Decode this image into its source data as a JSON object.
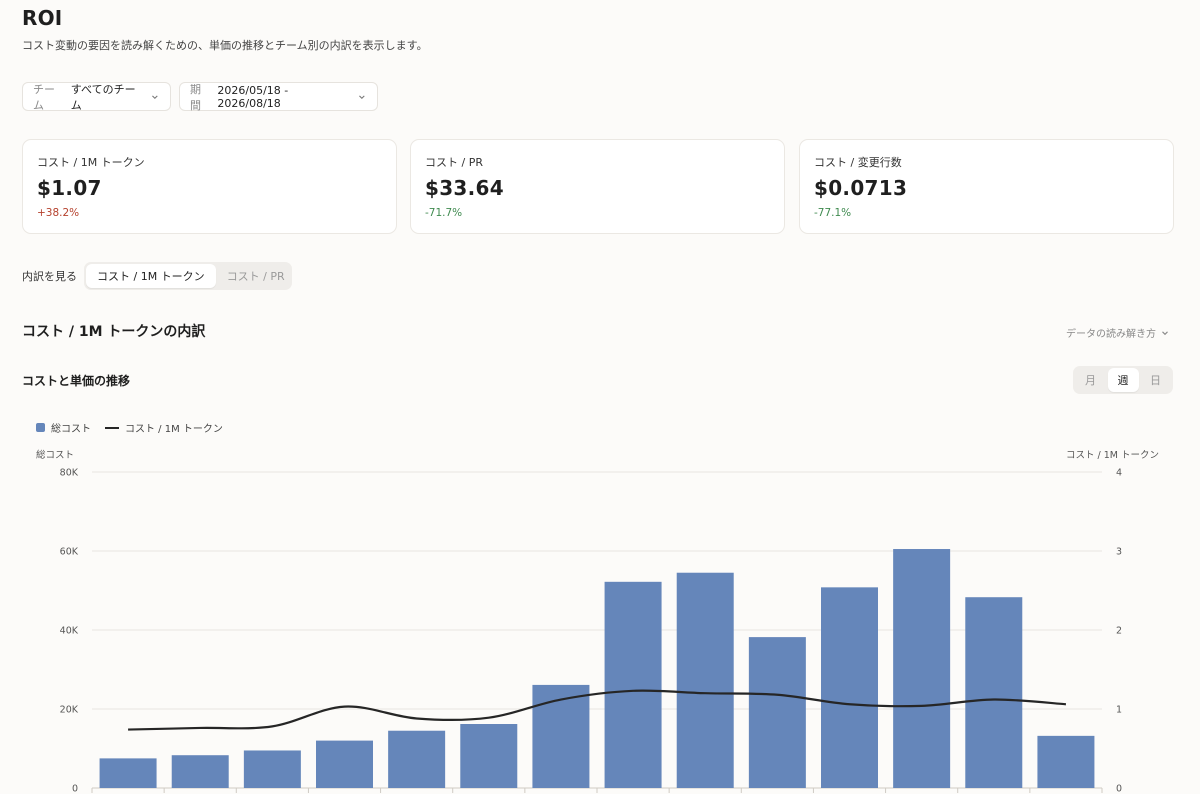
{
  "page": {
    "title": "ROI",
    "subtitle": "コスト変動の要因を読み解くための、単価の推移とチーム別の内訳を表示します。"
  },
  "filters": {
    "team": {
      "label": "チーム",
      "value": "すべてのチーム"
    },
    "period": {
      "label": "期間",
      "value": "2026/05/18 - 2026/08/18"
    }
  },
  "kpis": [
    {
      "label": "コスト / 1M トークン",
      "value": "$1.07",
      "delta": "+38.2%",
      "trend": "up"
    },
    {
      "label": "コスト / PR",
      "value": "$33.64",
      "delta": "-71.7%",
      "trend": "down"
    },
    {
      "label": "コスト / 変更行数",
      "value": "$0.0713",
      "delta": "-77.1%",
      "trend": "down"
    }
  ],
  "breakdown": {
    "label": "内訳を見る",
    "options": [
      "コスト / 1M トークン",
      "コスト / PR"
    ],
    "selected": 0
  },
  "section": {
    "title": "コスト / 1M トークンの内訳",
    "guide": "データの読み解き方"
  },
  "chart_header": {
    "title": "コストと単価の推移",
    "granularity": [
      "月",
      "週",
      "日"
    ],
    "selected": 1
  },
  "colors": {
    "bar": "#6586ba",
    "line": "#262626",
    "positive_delta": "#b5412d",
    "negative_delta": "#3f8a4f",
    "grid": "#e9e6e1"
  },
  "chart_data": {
    "type": "bar",
    "legend": [
      "総コスト",
      "コスト / 1M トークン"
    ],
    "legend_position": "top-left",
    "grid": true,
    "y_left": {
      "label": "総コスト",
      "ticks": [
        "0",
        "20K",
        "40K",
        "60K",
        "80K"
      ],
      "range": [
        0,
        80000
      ]
    },
    "y_right": {
      "label": "コスト / 1M トークン",
      "ticks": [
        "0",
        "1",
        "2",
        "3",
        "4"
      ],
      "range": [
        0,
        4
      ]
    },
    "series": [
      {
        "name": "総コスト",
        "type": "bar",
        "values": [
          7500,
          8300,
          9500,
          12000,
          14500,
          16200,
          26100,
          52200,
          54500,
          38200,
          50800,
          60500,
          48300,
          13200
        ]
      },
      {
        "name": "コスト / 1M トークン",
        "type": "line",
        "axis": "right",
        "values": [
          0.74,
          0.76,
          0.78,
          1.03,
          0.88,
          0.89,
          1.12,
          1.23,
          1.2,
          1.18,
          1.06,
          1.04,
          1.12,
          1.06
        ]
      }
    ]
  }
}
